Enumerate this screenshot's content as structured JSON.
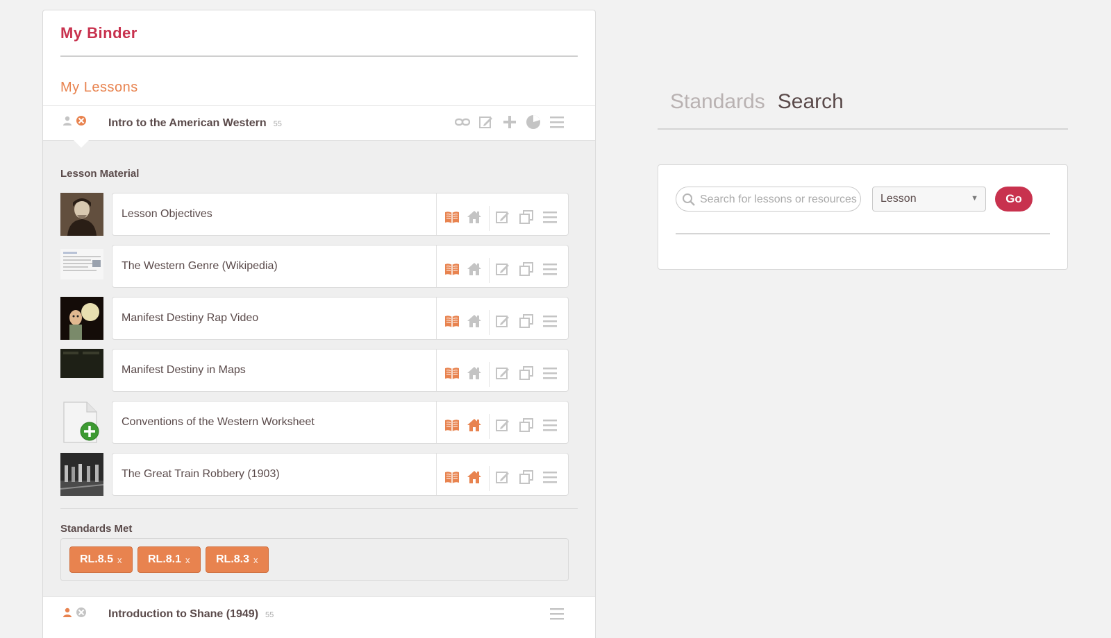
{
  "binder": {
    "title": "My Binder",
    "lessons_heading": "My Lessons",
    "lessons": [
      {
        "title": "Intro to the American Western",
        "count": "55"
      },
      {
        "title": "Introduction to Shane (1949)",
        "count": "55"
      }
    ],
    "lesson_material_label": "Lesson Material",
    "materials": [
      {
        "title": "Lesson Objectives",
        "home_active": false
      },
      {
        "title": "The Western Genre (Wikipedia)",
        "home_active": false
      },
      {
        "title": "Manifest Destiny Rap Video",
        "home_active": false
      },
      {
        "title": "Manifest Destiny in Maps",
        "home_active": false
      },
      {
        "title": "Conventions of the Western Worksheet",
        "home_active": true
      },
      {
        "title": "The Great Train Robbery (1903)",
        "home_active": true
      }
    ],
    "standards_label": "Standards Met",
    "standards": [
      {
        "code": "RL.8.5",
        "remove": "x"
      },
      {
        "code": "RL.8.1",
        "remove": "x"
      },
      {
        "code": "RL.8.3",
        "remove": "x"
      }
    ]
  },
  "right": {
    "tabs": [
      {
        "label": "Standards",
        "active": false
      },
      {
        "label": "Search",
        "active": true
      }
    ],
    "search": {
      "placeholder": "Search for lessons or resources",
      "type_value": "Lesson",
      "go_label": "Go"
    }
  },
  "colors": {
    "brand": "#c8324e",
    "accent": "#e8834f",
    "text": "#5a4a4a",
    "muted_icon": "#c4c4c4"
  }
}
